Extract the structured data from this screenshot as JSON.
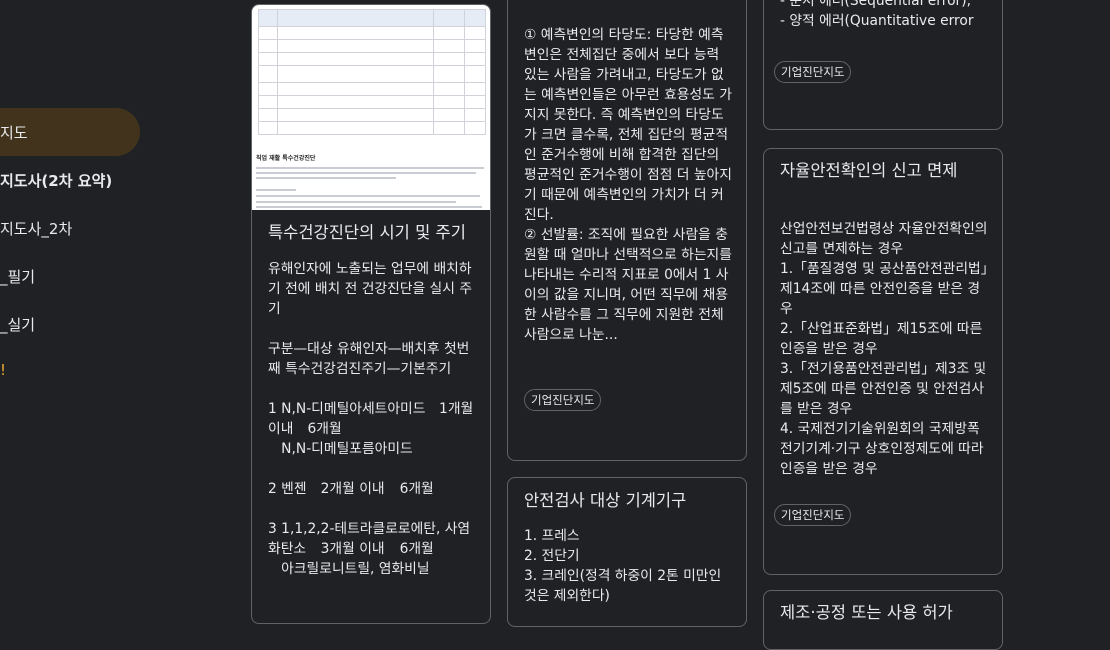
{
  "sidebar": {
    "items": [
      {
        "label": "지도",
        "active": true
      },
      {
        "label": "지도사(2차 요약)"
      },
      {
        "label": "지도사_2차"
      },
      {
        "label": "_필기"
      },
      {
        "label": "_실기"
      },
      {
        "label": "!"
      }
    ]
  },
  "cards": {
    "health_exam": {
      "image_doc_title": "직업 재활 특수건강진단",
      "title": "특수건강진단의 시기 및 주기",
      "body": "유해인자에 노출되는 업무에 배치하기 전에 배치 전 건강진단을 실시 주기\n\n구분—대상 유해인자—배치후 첫번째 특수건강검진주기—기본주기\n\n1\tN,N-디메틸아세트아미드\t1개월 이내\t6개월\n\tN,N-디메틸포름아미드\n\n2\t벤젠\t2개월 이내\t6개월\n\n3\t1,1,2,2-테트라클로로에탄, 사염화탄소\t3개월 이내\t6개월\n\t아크릴로니트릴, 염화비닐"
    },
    "predictor": {
      "body": "① 예측변인의 타당도: 타당한 예측변인은 전체집단 중에서 보다 능력 있는 사람을 가려내고, 타당도가 없는 예측변인들은 아무런 효용성도 가지지 못한다. 즉 예측변인의 타당도가 크면 클수록, 전체 집단의 평균적인 준거수행에 비해 합격한 집단의 평균적인 준거수행이 점점 더 높아지기 때문에 예측변인의 가치가 더 커진다.\n② 선발률: 조직에 필요한 사람을 충원할 때 얼마나 선택적으로 하는지를 나타내는 수리적 지표로 0에서 1 사이의 값을 지니며, 어떤 직무에 채용한 사람수를 그 직무에 지원한 전체 사람으로 나눈...",
      "chip": "기업진단지도"
    },
    "inspection": {
      "title": "안전검사 대상 기계기구",
      "body": "1. 프레스\n2. 전단기\n3. 크레인(정격 하중이 2톤 미만인 것은 제외한다)"
    },
    "errors": {
      "body": "- 순서 에러(Sequential error),\n- 양적 에러(Quantitative error",
      "chip": "기업진단지도"
    },
    "self_safety": {
      "title": "자율안전확인의 신고 면제",
      "body": "산업안전보건법령상 자율안전확인의 신고를 면제하는 경우\n1.「품질경영 및 공산품안전관리법」제14조에 따른 안전인증을 받은 경우\n2.「산업표준화법」제15조에 따른 인증을 받은 경우\n3.「전기용품안전관리법」제3조 및 제5조에 따른 안전인증 및 안전검사를 받은 경우\n4. 국제전기기술위원회의 국제방폭전기기계·기구 상호인정제도에 따라 인증을 받은 경우",
      "chip": "기업진단지도"
    },
    "bottom_partial": {
      "title": "제조·공정 또는 사용 허가"
    }
  }
}
